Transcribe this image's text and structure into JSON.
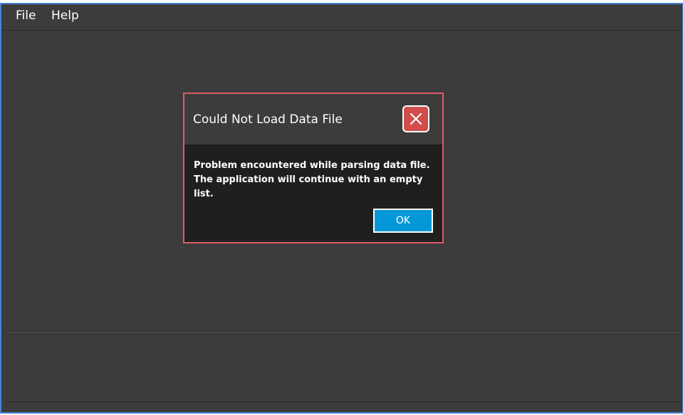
{
  "menubar": {
    "items": [
      {
        "label": "File"
      },
      {
        "label": "Help"
      }
    ]
  },
  "dialog": {
    "title": "Could Not Load Data File",
    "icon": "error-close-icon",
    "message": "Problem encountered while parsing data file. The application will continue with an empty list.",
    "ok_label": "OK"
  },
  "colors": {
    "window_border": "#4a83d6",
    "app_background": "#3c3c3c",
    "dialog_border": "#e05a66",
    "dialog_body": "#1f1f1f",
    "error_icon": "#d24c4c",
    "ok_button": "#0598d8"
  }
}
